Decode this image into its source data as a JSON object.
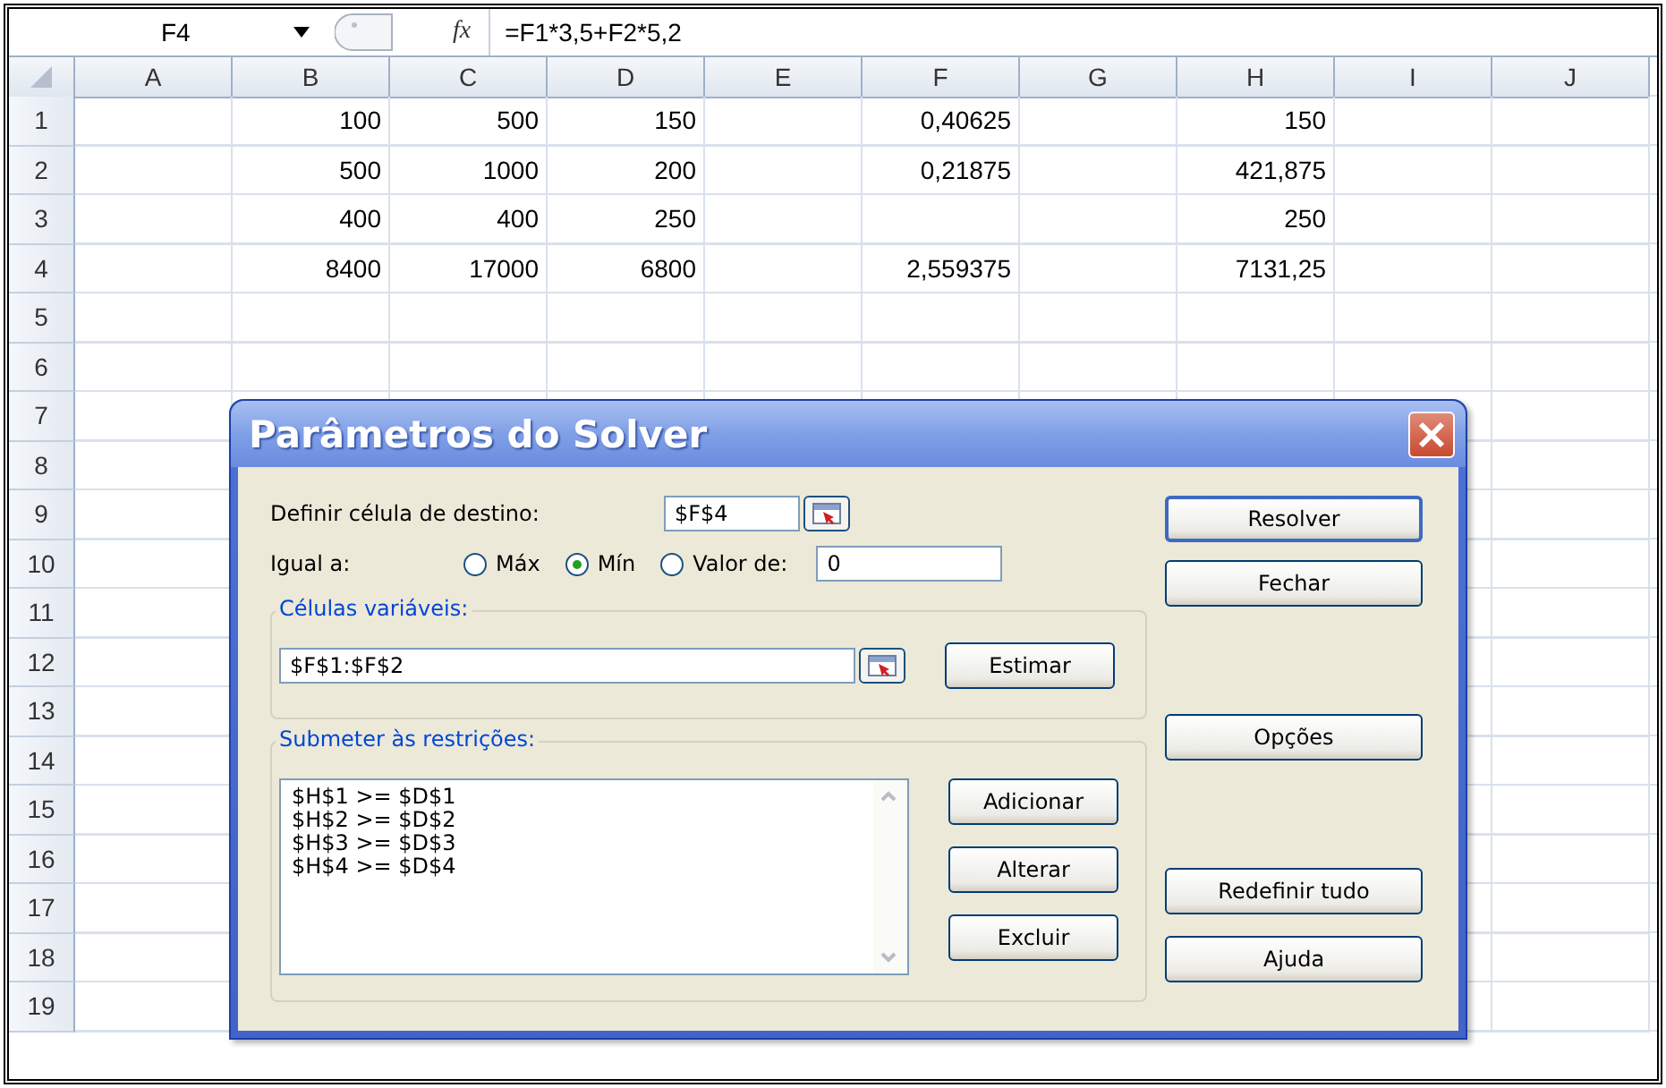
{
  "name_box": "F4",
  "formula_bar": {
    "fx_label": "fx",
    "formula": "=F1*3,5+F2*5,2"
  },
  "columns": [
    "A",
    "B",
    "C",
    "D",
    "E",
    "F",
    "G",
    "H",
    "I",
    "J"
  ],
  "rows": [
    {
      "header": "1",
      "cells": [
        null,
        "100",
        "500",
        "150",
        null,
        "0,40625",
        null,
        "150",
        null,
        null
      ]
    },
    {
      "header": "2",
      "cells": [
        null,
        "500",
        "1000",
        "200",
        null,
        "0,21875",
        null,
        "421,875",
        null,
        null
      ]
    },
    {
      "header": "3",
      "cells": [
        null,
        "400",
        "400",
        "250",
        null,
        null,
        null,
        "250",
        null,
        null
      ]
    },
    {
      "header": "4",
      "cells": [
        null,
        "8400",
        "17000",
        "6800",
        null,
        "2,559375",
        null,
        "7131,25",
        null,
        null
      ]
    },
    {
      "header": "5"
    },
    {
      "header": "6"
    },
    {
      "header": "7"
    },
    {
      "header": "8"
    },
    {
      "header": "9"
    },
    {
      "header": "10"
    },
    {
      "header": "11"
    },
    {
      "header": "12"
    },
    {
      "header": "13"
    },
    {
      "header": "14"
    },
    {
      "header": "15"
    },
    {
      "header": "16"
    },
    {
      "header": "17"
    },
    {
      "header": "18"
    },
    {
      "header": "19"
    }
  ],
  "dialog": {
    "title": "Parâmetros do Solver",
    "target": {
      "label": "Definir célula de destino:",
      "value": "$F$4"
    },
    "equal_to": {
      "label": "Igual a:",
      "options": [
        {
          "label": "Máx",
          "selected": false
        },
        {
          "label": "Mín",
          "selected": true
        },
        {
          "label": "Valor de:",
          "selected": false
        }
      ],
      "value": "0"
    },
    "variable_cells": {
      "legend": "Células variáveis:",
      "value": "$F$1:$F$2",
      "button": "Estimar"
    },
    "constraints": {
      "legend": "Submeter às restrições:",
      "items": [
        "$H$1 >= $D$1",
        "$H$2 >= $D$2",
        "$H$3 >= $D$3",
        "$H$4 >= $D$4"
      ],
      "buttons": [
        "Adicionar",
        "Alterar",
        "Excluir"
      ]
    },
    "side_buttons": [
      {
        "label": "Resolver",
        "default": true
      },
      {
        "label": "Fechar",
        "default": false
      },
      {
        "label": "Opções",
        "default": false
      },
      {
        "label": "Redefinir tudo",
        "default": false
      },
      {
        "label": "Ajuda",
        "default": false
      }
    ]
  }
}
